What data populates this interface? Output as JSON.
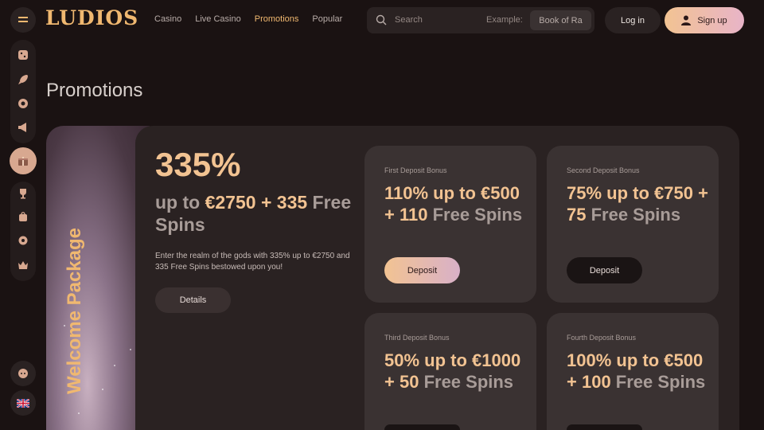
{
  "header": {
    "logo": "LUDIOS",
    "nav": [
      "Casino",
      "Live Casino",
      "Promotions",
      "Popular"
    ],
    "nav_active": "Promotions",
    "search_placeholder": "Search",
    "search_example_label": "Example:",
    "search_example_value": "Book of Ra",
    "login_label": "Log in",
    "signup_label": "Sign up"
  },
  "sidebar": {
    "icons": [
      "dice-icon",
      "rocket-icon",
      "poker-chip-icon",
      "megaphone-icon",
      "gift-icon",
      "trophy-icon",
      "bag-icon",
      "gear-icon",
      "crown-icon",
      "chat-icon",
      "uk-flag-icon"
    ],
    "active": "gift-icon"
  },
  "page": {
    "title": "Promotions",
    "welcome_label": "Welcome Package",
    "headline_pct": "335%",
    "headline_line1_a": "up to ",
    "headline_line1_b": "€2750",
    "headline_line1_c": " + ",
    "headline_line1_d": "335",
    "headline_line1_e": " Free Spins",
    "description": "Enter the realm of the gods with 335% up to €2750 and 335 Free Spins bestowed upon you!",
    "details_label": "Details"
  },
  "cards": [
    {
      "label": "First Deposit Bonus",
      "a": "110%",
      "b": " up to ",
      "c": "€500",
      "d": " + ",
      "e": "110",
      "f": " Free Spins",
      "button": "Deposit",
      "style": "grad"
    },
    {
      "label": "Second Deposit Bonus",
      "a": "75%",
      "b": " up to ",
      "c": "€750",
      "d": " + ",
      "e": "75",
      "f": " Free Spins",
      "button": "Deposit",
      "style": "dark"
    },
    {
      "label": "Third Deposit Bonus",
      "a": "50%",
      "b": " up to ",
      "c": "€1000",
      "d": " + ",
      "e": "50",
      "f": " Free Spins",
      "button": "",
      "style": "dark"
    },
    {
      "label": "Fourth Deposit Bonus",
      "a": "100%",
      "b": " up to ",
      "c": "€500",
      "d": " + ",
      "e": "100",
      "f": " Free Spins",
      "button": "",
      "style": "dark"
    }
  ],
  "colors": {
    "accent": "#f2c392",
    "background": "#1a1212",
    "panel": "#2a2222",
    "card": "#3a3232"
  }
}
